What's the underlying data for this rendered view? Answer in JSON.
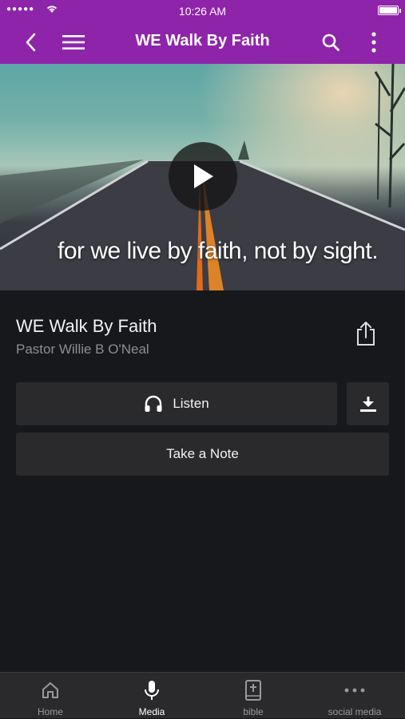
{
  "status_bar": {
    "time": "10:26 AM",
    "signal": "●●●●●"
  },
  "app_bar": {
    "title": "WE Walk By Faith"
  },
  "hero": {
    "caption": "for we live by faith, not by sight."
  },
  "media": {
    "title": "WE Walk By Faith",
    "author": "Pastor Willie B O'Neal"
  },
  "actions": {
    "listen_label": "Listen",
    "note_label": "Take a Note"
  },
  "tabs": [
    {
      "label": "Home",
      "icon": "home-icon"
    },
    {
      "label": "Media",
      "icon": "microphone-icon",
      "active": true
    },
    {
      "label": "bible",
      "icon": "bible-icon"
    },
    {
      "label": "social media",
      "icon": "more-dots-icon"
    }
  ],
  "colors": {
    "accent": "#8e24aa",
    "background": "#17181b",
    "button": "#2a2a2d"
  }
}
